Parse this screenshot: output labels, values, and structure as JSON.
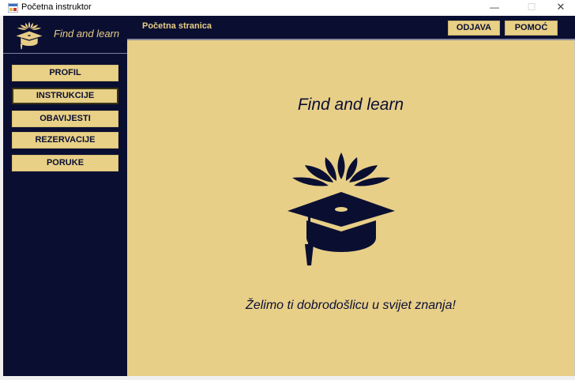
{
  "window": {
    "title": "Početna instruktor",
    "controls": {
      "minimize": "—",
      "maximize": "☐",
      "close": "✕"
    },
    "icon": "app-window-icon"
  },
  "sidebar": {
    "brand": "Find and learn",
    "logo_icon": "graduation-cap-icon",
    "items": [
      {
        "label": "PROFIL"
      },
      {
        "label": "INSTRUKCIJE",
        "active": true
      },
      {
        "label": "OBAVIJESTI"
      },
      {
        "label": "REZERVACIJE"
      },
      {
        "label": "PORUKE"
      }
    ]
  },
  "header": {
    "title": "Početna stranica",
    "buttons": {
      "logout": "ODJAVA",
      "help": "POMOĆ"
    }
  },
  "main": {
    "title": "Find and learn",
    "hero_icon": "graduation-cap-icon",
    "welcome": "Želimo ti dobrodošlicu u svijet znanja!"
  },
  "colors": {
    "navy": "#0a0f32",
    "gold": "#e8cf88",
    "button_gold": "#e8d086"
  }
}
